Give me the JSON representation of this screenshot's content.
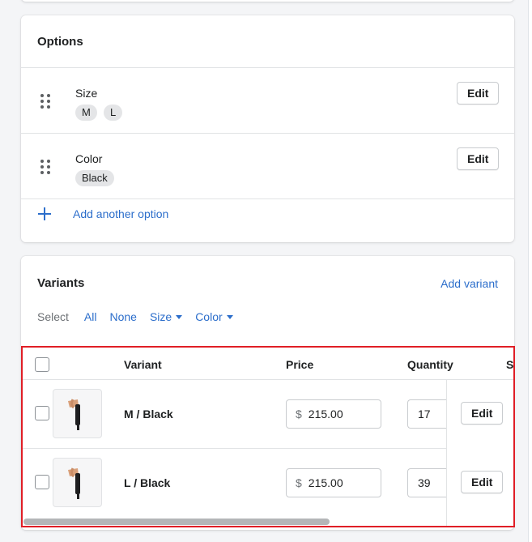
{
  "options": {
    "title": "Options",
    "items": [
      {
        "name": "Size",
        "values": [
          "M",
          "L"
        ],
        "edit_label": "Edit"
      },
      {
        "name": "Color",
        "values": [
          "Black"
        ],
        "edit_label": "Edit"
      }
    ],
    "add_label": "Add another option"
  },
  "variants": {
    "title": "Variants",
    "add_label": "Add variant",
    "select": {
      "label": "Select",
      "all": "All",
      "none": "None",
      "size": "Size",
      "color": "Color"
    },
    "columns": {
      "variant": "Variant",
      "price": "Price",
      "quantity": "Quantity",
      "s_cut": "S"
    },
    "rows": [
      {
        "name": "M / Black",
        "currency": "$",
        "price": "215.00",
        "quantity": "17",
        "edit_label": "Edit"
      },
      {
        "name": "L / Black",
        "currency": "$",
        "price": "215.00",
        "quantity": "39",
        "edit_label": "Edit"
      }
    ]
  },
  "colors": {
    "link": "#2c6ecb",
    "highlight": "#e01e26"
  },
  "icons": [
    "drag-handle-icon",
    "plus-icon",
    "caret-down-icon",
    "product-thumbnail-image"
  ]
}
